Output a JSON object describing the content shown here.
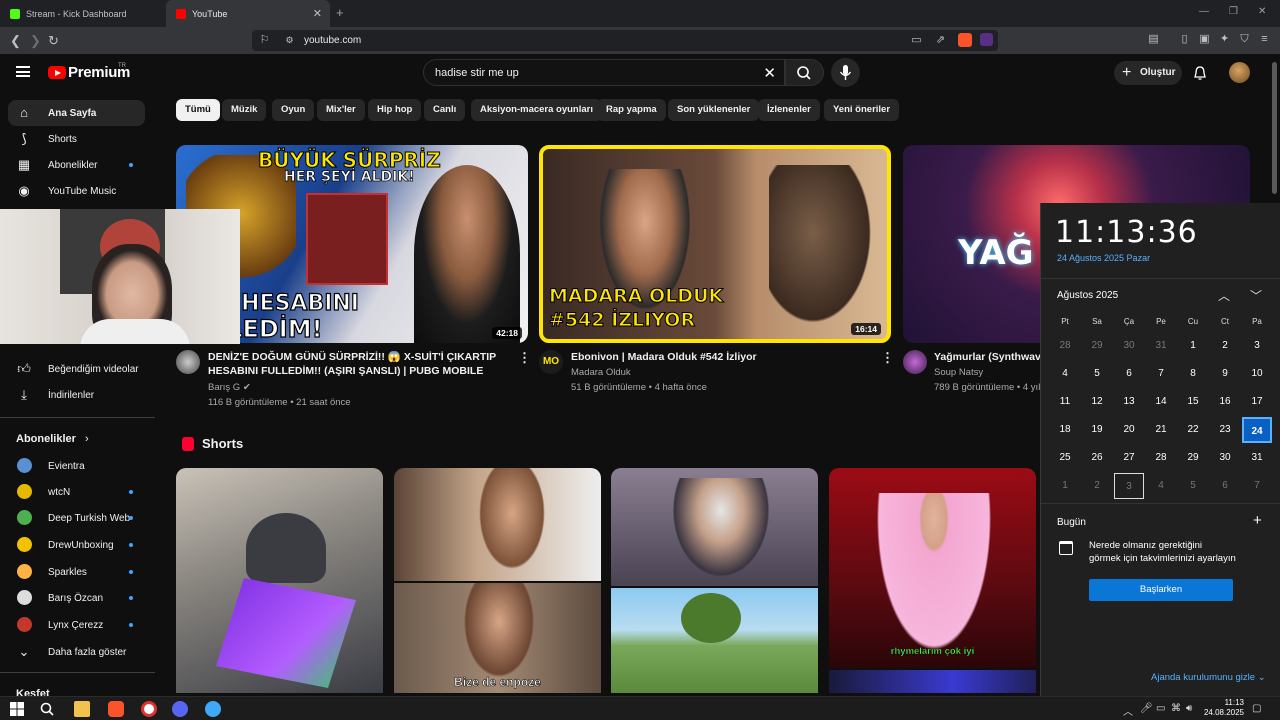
{
  "browser": {
    "tabs": [
      {
        "label": "Stream - Kick Dashboard",
        "favicon_color": "#53fc18"
      },
      {
        "label": "YouTube",
        "favicon_color": "#ff0000"
      }
    ],
    "url": "youtube.com"
  },
  "header": {
    "brand": "Premium",
    "brand_sup": "TR",
    "search_query": "hadise stir me up",
    "create_label": "Oluştur"
  },
  "sidebar": {
    "items": [
      {
        "label": "Ana Sayfa",
        "icon": "home-icon"
      },
      {
        "label": "Shorts",
        "icon": "shorts-icon"
      },
      {
        "label": "Abonelikler",
        "icon": "subscriptions-icon"
      },
      {
        "label": "YouTube Music",
        "icon": "music-icon"
      }
    ],
    "lower_items": [
      {
        "label": "Beğendiğim videolar",
        "icon": "like-icon"
      },
      {
        "label": "İndirilenler",
        "icon": "download-icon"
      }
    ],
    "subs_title": "Abonelikler",
    "channels": [
      {
        "label": "Evientra",
        "color": "#5a8fd1"
      },
      {
        "label": "wtcN",
        "color": "#e6b800"
      },
      {
        "label": "Deep Turkish Web",
        "color": "#4caf50"
      },
      {
        "label": "DrewUnboxing",
        "color": "#f2c200"
      },
      {
        "label": "Sparkles",
        "color": "#ffb347"
      },
      {
        "label": "Barış Özcan",
        "color": "#dddddd"
      },
      {
        "label": "Lynx Çerezz",
        "color": "#c0392b"
      }
    ],
    "show_more": "Daha fazla göster",
    "partial_section": "Keşfet"
  },
  "chips": [
    "Tümü",
    "Müzik",
    "Oyun",
    "Mix'ler",
    "Hip hop",
    "Canlı",
    "Aksiyon-macera oyunları",
    "Rap yapma",
    "Son yüklenenler",
    "İzlenenler",
    "Yeni öneriler"
  ],
  "videos": [
    {
      "title_line1": "DENİZ'E DOĞUM GÜNÜ SÜRPRİZİ!! 😱 X-SUİT'İ ÇIKARTIP",
      "title_line2": "HESABINI FULLEDİM!! (AŞIRI ŞANSLI) | PUBG MOBILE",
      "channel": "Barış G",
      "meta": "116 B görüntüleme • 21 saat önce",
      "duration": "42:18",
      "thumb_text1": "BÜYÜK SÜRPRİZ",
      "thumb_text2": "HER ŞEYİ ALDIK!",
      "thumb_text3": "İZ'İN HESABINI",
      "thumb_text4": "FULLEDİM!"
    },
    {
      "title_line1": "Ebonivon | Madara Olduk #542 İzliyor",
      "channel": "Madara Olduk",
      "meta": "51 B görüntüleme • 4 hafta önce",
      "duration": "16:14",
      "thumb_text1": "MADARA OLDUK",
      "thumb_text2": "#542 İZLIYOR",
      "channel_badge": "MO"
    },
    {
      "title_line1": "Yağmurlar (Synthwave",
      "channel": "Soup Natsy",
      "meta": "789 B görüntüleme • 4 yıl",
      "thumb_text1": "YAĞ"
    }
  ],
  "shorts": {
    "title": "Shorts",
    "captions": [
      "Bize de enpoze",
      "rhymelarım çok iyi"
    ]
  },
  "calendar": {
    "time": "11:13:36",
    "date": "24 Ağustos 2025 Pazar",
    "month": "Ağustos 2025",
    "dows": [
      "Pt",
      "Sa",
      "Ça",
      "Pe",
      "Cu",
      "Ct",
      "Pa"
    ],
    "weeks": [
      [
        "28",
        "29",
        "30",
        "31",
        "1",
        "2",
        "3"
      ],
      [
        "4",
        "5",
        "6",
        "7",
        "8",
        "9",
        "10"
      ],
      [
        "11",
        "12",
        "13",
        "14",
        "15",
        "16",
        "17"
      ],
      [
        "18",
        "19",
        "20",
        "21",
        "22",
        "23",
        "24"
      ],
      [
        "25",
        "26",
        "27",
        "28",
        "29",
        "30",
        "31"
      ],
      [
        "1",
        "2",
        "3",
        "4",
        "5",
        "6",
        "7"
      ]
    ],
    "today": "24",
    "today_label": "Bugün",
    "message_line1": "Nerede olmanız gerektiğini",
    "message_line2": "görmek için takvimlerinizi ayarlayın",
    "cta": "Başlarken",
    "hide": "Ajanda kurulumunu gizle"
  },
  "taskbar": {
    "time": "11:13",
    "date": "24.08.2025"
  }
}
